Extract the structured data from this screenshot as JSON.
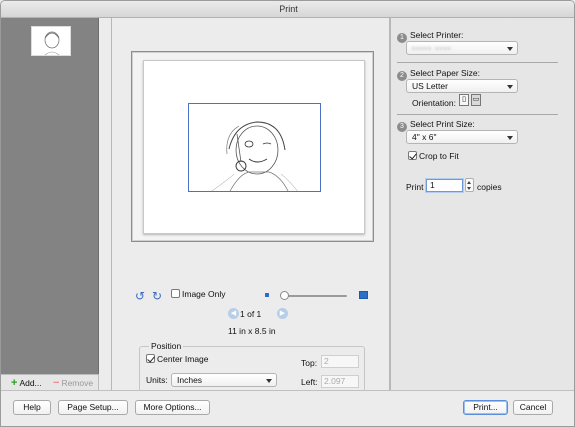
{
  "window": {
    "title": "Print"
  },
  "sidebar": {
    "add_label": "Add...",
    "remove_label": "Remove"
  },
  "preview": {
    "image_only_label": "Image Only",
    "page_indicator": "1 of 1",
    "paper_dimensions": "11 in x 8.5 in",
    "zoom_level": 0.0
  },
  "position": {
    "legend": "Position",
    "center_image_label": "Center Image",
    "center_image_checked": true,
    "units_label": "Units:",
    "units_value": "Inches",
    "top_label": "Top:",
    "top_value": "2",
    "left_label": "Left:",
    "left_value": "2.097"
  },
  "panel": {
    "step1": {
      "number": "1",
      "label": "Select Printer:"
    },
    "step2": {
      "number": "2",
      "label": "Select Paper Size:",
      "paper_value": "US Letter",
      "orientation_label": "Orientation:"
    },
    "step3": {
      "number": "3",
      "label": "Select Print Size:",
      "size_value": "4\" x 6\"",
      "crop_label": "Crop to Fit",
      "crop_checked": true
    },
    "print_label": "Print",
    "copies_value": "1",
    "copies_label": "copies"
  },
  "buttons": {
    "help": "Help",
    "page_setup": "Page Setup...",
    "more_options": "More Options...",
    "print": "Print...",
    "cancel": "Cancel"
  },
  "colors": {
    "accent": "#3c6dbd",
    "photo_border": "#4a73c6",
    "add_green": "#2e9c2e"
  }
}
